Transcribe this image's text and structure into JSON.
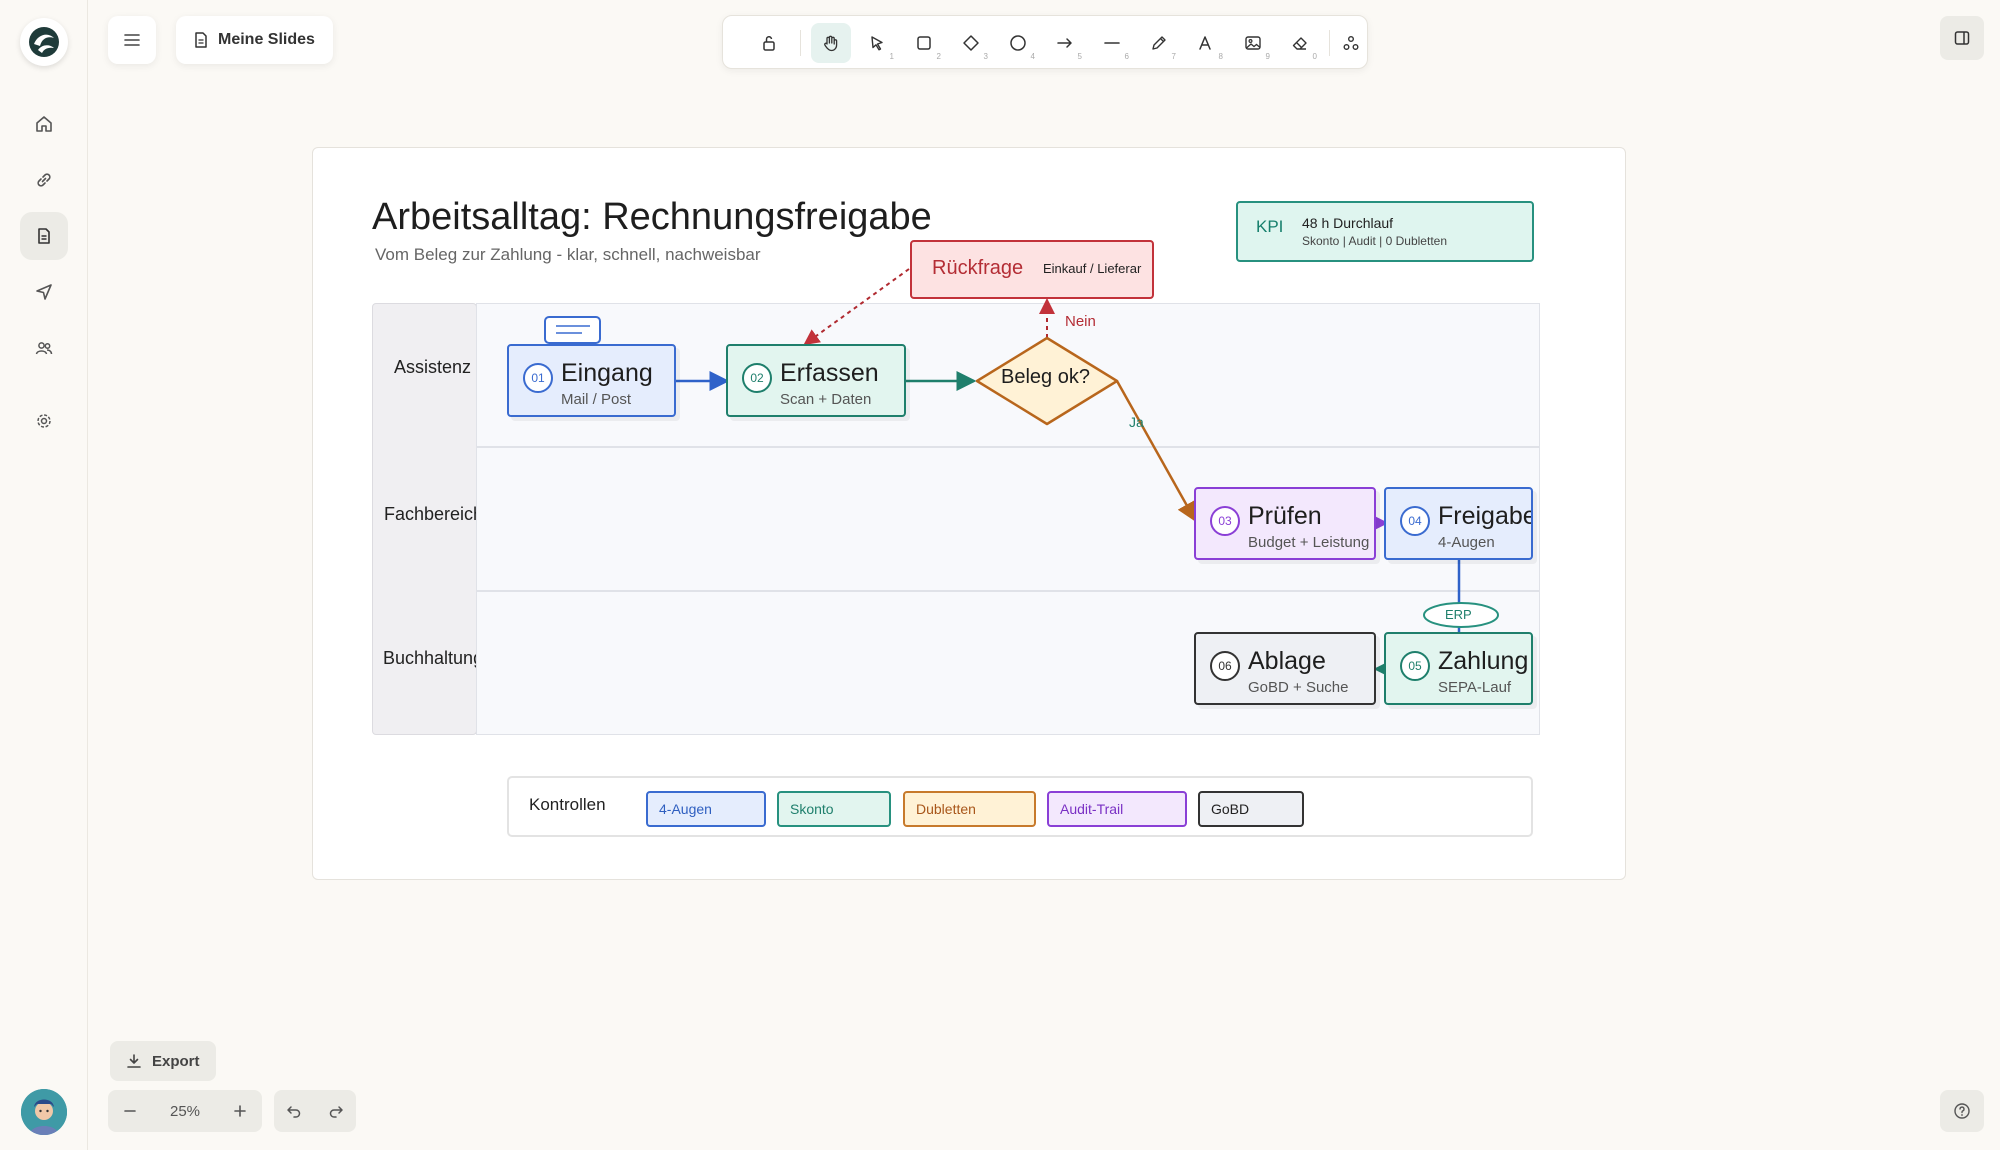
{
  "header": {
    "document_title": "Meine Slides"
  },
  "toolbar": {
    "tools": [
      {
        "name": "lock",
        "key": ""
      },
      {
        "name": "hand",
        "key": ""
      },
      {
        "name": "select",
        "key": "1"
      },
      {
        "name": "rectangle",
        "key": "2"
      },
      {
        "name": "diamond",
        "key": "3"
      },
      {
        "name": "ellipse",
        "key": "4"
      },
      {
        "name": "arrow",
        "key": "5"
      },
      {
        "name": "line",
        "key": "6"
      },
      {
        "name": "draw",
        "key": "7"
      },
      {
        "name": "text",
        "key": "8"
      },
      {
        "name": "image",
        "key": "9"
      },
      {
        "name": "eraser",
        "key": "0"
      },
      {
        "name": "more-tools",
        "key": ""
      }
    ],
    "active_tool": "hand"
  },
  "footer": {
    "export_label": "Export",
    "zoom": "25%"
  },
  "slide": {
    "title": "Arbeitsalltag: Rechnungsfreigabe",
    "subtitle": "Vom Beleg zur Zahlung - klar, schnell, nachweisbar",
    "kpi": {
      "label": "KPI",
      "main": "48 h Durchlauf",
      "sub": "Skonto | Audit | 0 Dubletten"
    },
    "rueckfrage": {
      "title": "Rückfrage",
      "sub": "Einkauf / Lieferar"
    },
    "lanes": [
      "Assistenz",
      "Fachbereich",
      "Buchhaltung"
    ],
    "nodes": {
      "eingang": {
        "num": "01",
        "title": "Eingang",
        "sub": "Mail / Post"
      },
      "erfassen": {
        "num": "02",
        "title": "Erfassen",
        "sub": "Scan + Daten"
      },
      "pruefen": {
        "num": "03",
        "title": "Prüfen",
        "sub": "Budget + Leistung"
      },
      "freigabe": {
        "num": "04",
        "title": "Freigabe",
        "sub": "4-Augen"
      },
      "zahlung": {
        "num": "05",
        "title": "Zahlung",
        "sub": "SEPA-Lauf"
      },
      "ablage": {
        "num": "06",
        "title": "Ablage",
        "sub": "GoBD + Suche"
      }
    },
    "decision": {
      "label": "Beleg ok?",
      "no": "Nein",
      "yes": "Ja"
    },
    "erp_label": "ERP",
    "controls": {
      "label": "Kontrollen",
      "chips": [
        "4-Augen",
        "Skonto",
        "Dubletten",
        "Audit-Trail",
        "GoBD"
      ]
    }
  },
  "colors": {
    "accent_green": "#27917f",
    "blue": "#2f62c9",
    "purple": "#8a3fd6",
    "orange": "#b8661c",
    "red": "#c2323a"
  }
}
